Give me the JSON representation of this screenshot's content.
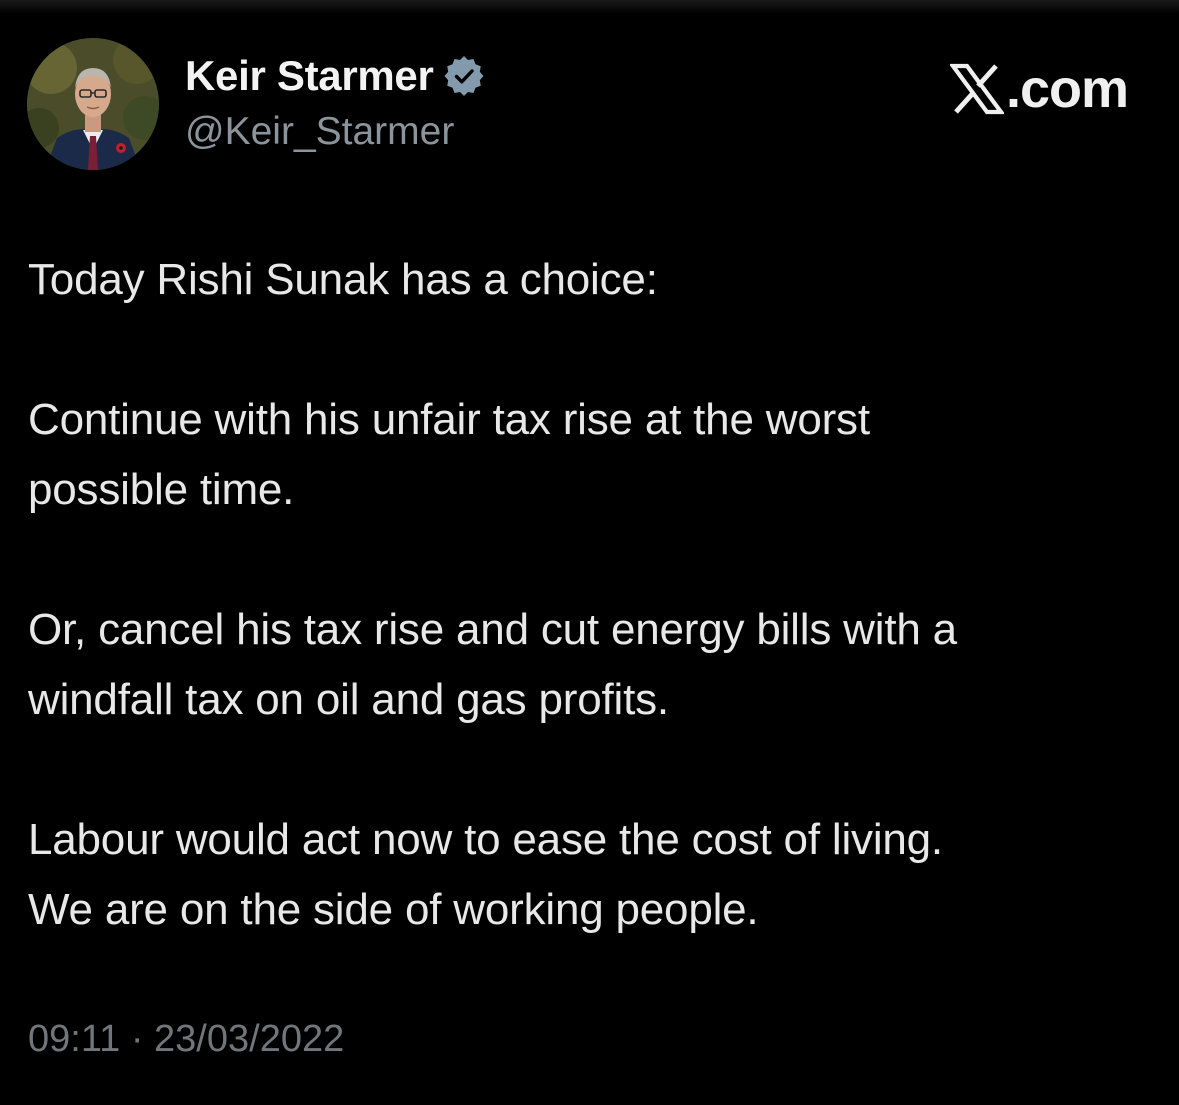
{
  "profile": {
    "name": "Keir Starmer",
    "handle": "@Keir_Starmer",
    "avatar_icon": "profile-photo",
    "verified_icon": "verified-badge-icon"
  },
  "brand": {
    "label": ".com",
    "icon": "x-logo-icon"
  },
  "tweet": {
    "paragraphs": [
      "Today Rishi Sunak has a choice:",
      "Continue with his unfair tax rise at the worst\npossible time.",
      "Or, cancel his tax rise and cut energy bills with a\nwindfall tax on oil and gas profits.",
      "Labour would act now to ease the cost of living.\nWe are on the side of working people."
    ],
    "timestamp": "09:11 · 23/03/2022"
  },
  "colors": {
    "background": "#000000",
    "text": "#e7e9ea",
    "muted": "#71767b",
    "verified": "#829aab"
  }
}
